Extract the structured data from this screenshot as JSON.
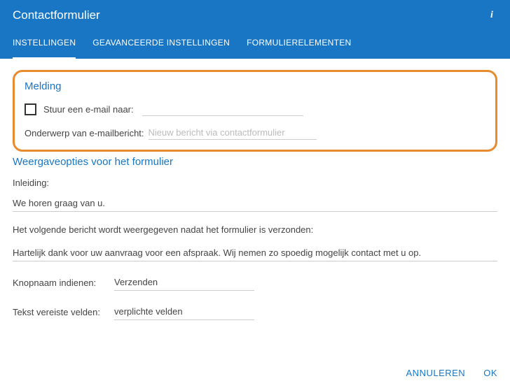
{
  "header": {
    "title": "Contactformulier"
  },
  "tabs": {
    "settings": "INSTELLINGEN",
    "advanced": "GEAVANCEERDE INSTELLINGEN",
    "elements": "FORMULIERELEMENTEN"
  },
  "notification": {
    "title": "Melding",
    "send_email_label": "Stuur een e-mail naar:",
    "email_value": "",
    "subject_label": "Onderwerp van e-mailbericht:",
    "subject_placeholder": "Nieuw bericht via contactformulier"
  },
  "display": {
    "title": "Weergaveopties voor het formulier",
    "intro_label": "Inleiding:",
    "intro_value": "We horen graag van u.",
    "after_submit_label": "Het volgende bericht wordt weergegeven nadat het formulier is verzonden:",
    "after_submit_value": "Hartelijk dank voor uw aanvraag voor een afspraak. Wij nemen zo spoedig mogelijk contact met u op.",
    "button_name_label": "Knopnaam indienen:",
    "button_name_value": "Verzenden",
    "required_label": "Tekst vereiste velden:",
    "required_value": "verplichte velden"
  },
  "footer": {
    "cancel": "ANNULEREN",
    "ok": "OK"
  }
}
